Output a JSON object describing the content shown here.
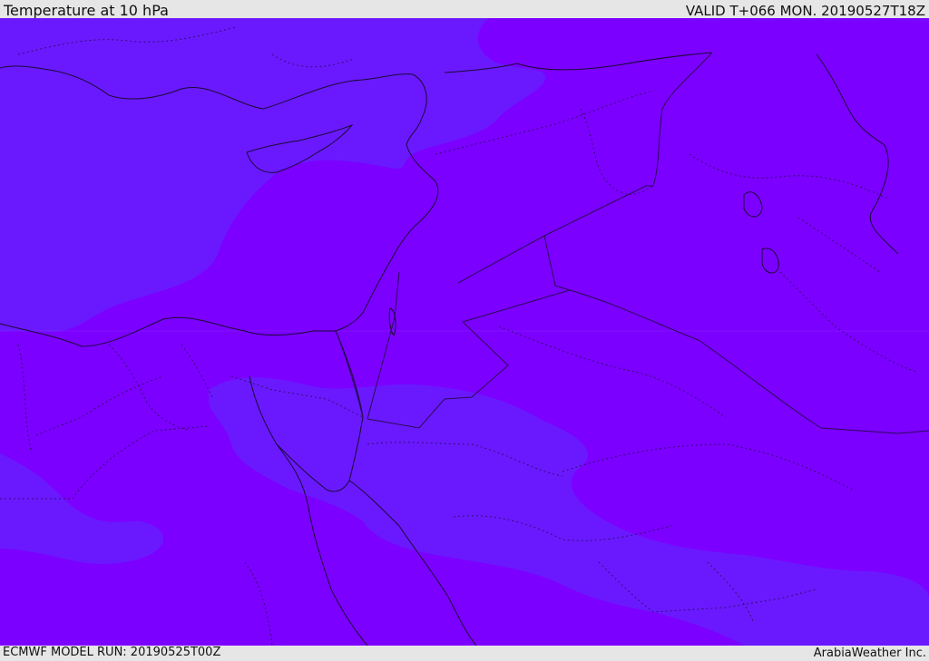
{
  "header": {
    "title": "Temperature at 10 hPa",
    "valid": "VALID T+066 MON. 20190527T18Z"
  },
  "footer": {
    "model_run": "ECMWF MODEL RUN: 20190525T00Z",
    "credit": "ArabiaWeather Inc."
  },
  "map": {
    "colors": {
      "background_band": "#7c00ff",
      "cooler_band": "#6a19ff",
      "coastline": "#1a0a33",
      "border": "#2a0b55"
    }
  }
}
